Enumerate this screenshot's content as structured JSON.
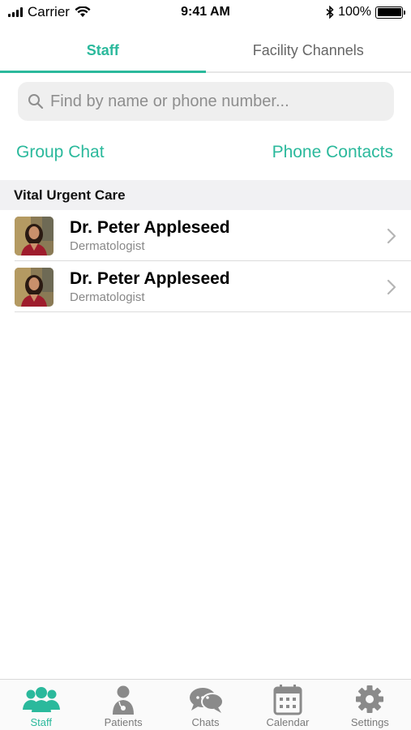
{
  "status_bar": {
    "carrier": "Carrier",
    "time": "9:41 AM",
    "battery": "100%"
  },
  "top_tabs": [
    {
      "label": "Staff",
      "active": true
    },
    {
      "label": "Facility Channels",
      "active": false
    }
  ],
  "search": {
    "placeholder": "Find by name or phone number...",
    "value": ""
  },
  "links": {
    "group_chat": "Group Chat",
    "phone_contacts": "Phone Contacts"
  },
  "section": {
    "title": "Vital Urgent Care"
  },
  "staff": [
    {
      "name": "Dr. Peter Appleseed",
      "role": "Dermatologist"
    },
    {
      "name": "Dr. Peter Appleseed",
      "role": "Dermatologist"
    }
  ],
  "tabbar": [
    {
      "label": "Staff",
      "icon": "staff-icon",
      "active": true
    },
    {
      "label": "Patients",
      "icon": "patients-icon",
      "active": false
    },
    {
      "label": "Chats",
      "icon": "chats-icon",
      "active": false
    },
    {
      "label": "Calendar",
      "icon": "calendar-icon",
      "active": false
    },
    {
      "label": "Settings",
      "icon": "settings-icon",
      "active": false
    }
  ],
  "colors": {
    "accent": "#2bb99c",
    "inactive_icon": "#8a8a8a",
    "section_bg": "#f1f1f3"
  }
}
